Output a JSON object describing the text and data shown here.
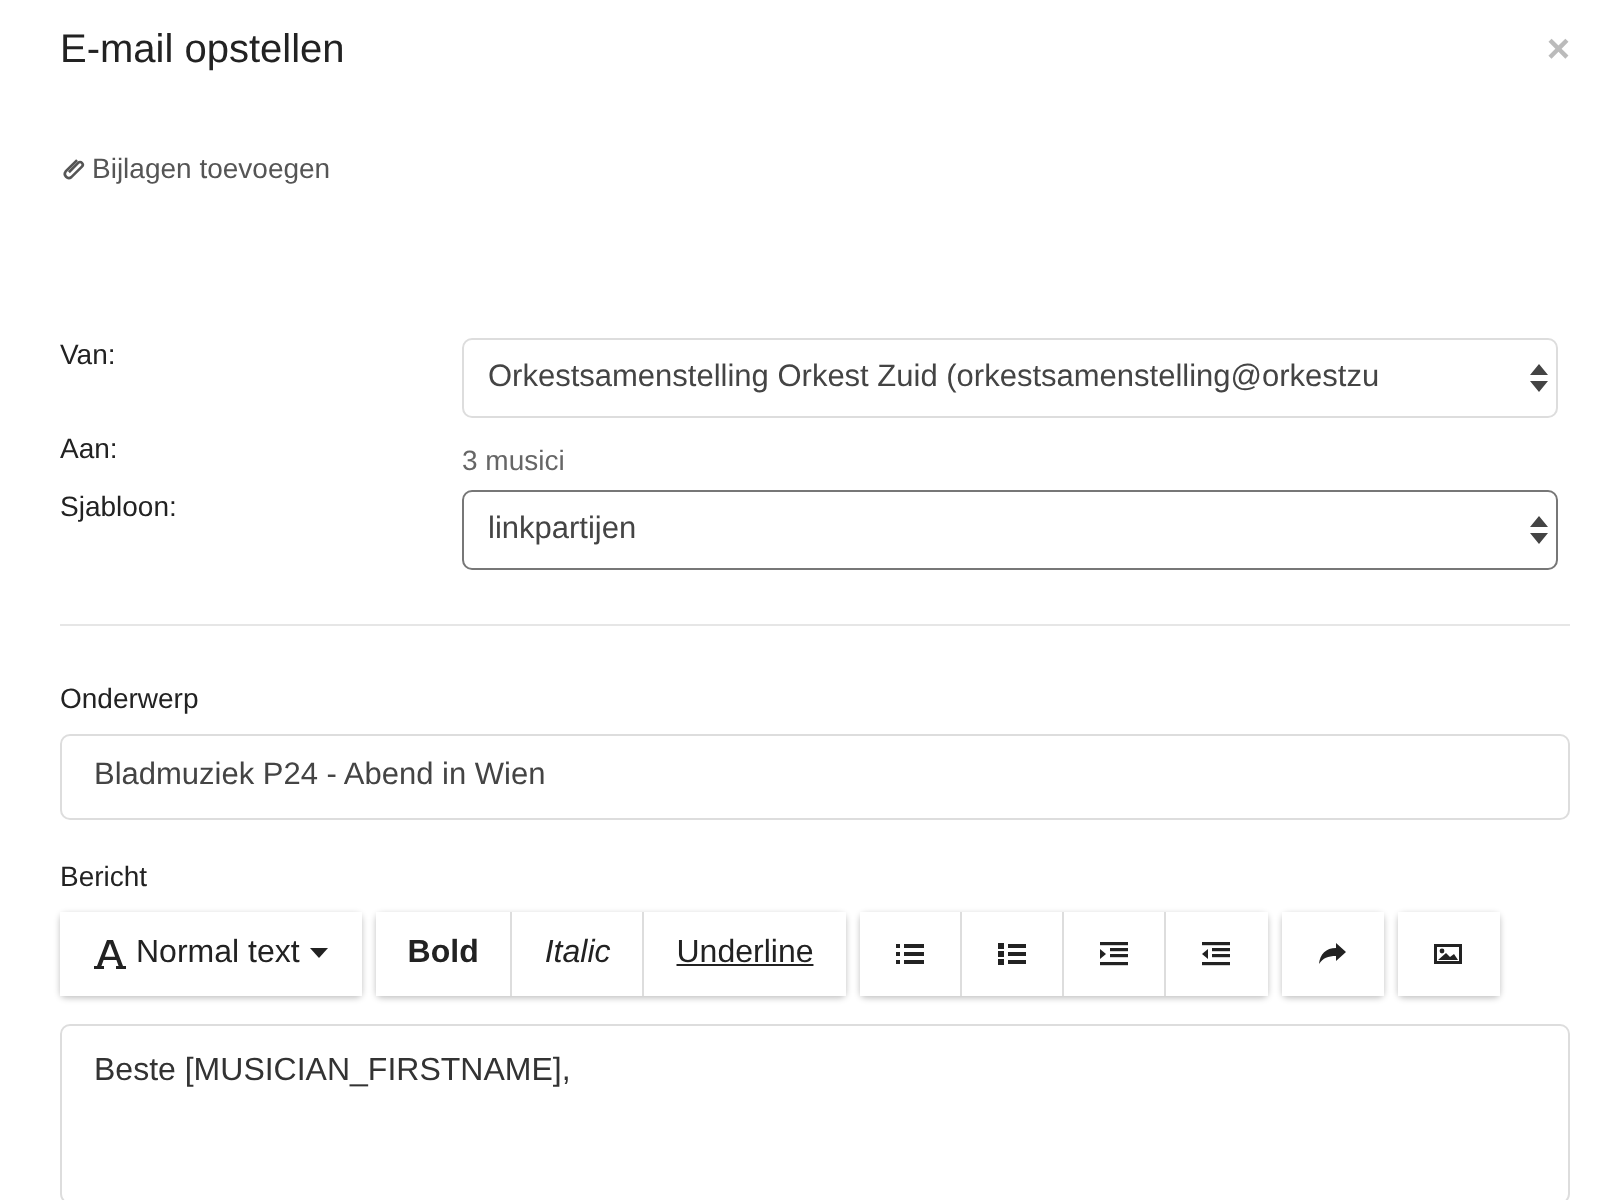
{
  "dialog": {
    "title": "E-mail opstellen",
    "close": "×"
  },
  "attachments": {
    "label": "Bijlagen toevoegen"
  },
  "fields": [
    {
      "kind": "select",
      "label": "Van:",
      "value": "Orkestsamenstelling Orkest Zuid (orkestsamenstelling@orkestzu",
      "focused": false
    },
    {
      "kind": "text",
      "label": "Aan:",
      "value": "3 musici"
    },
    {
      "kind": "select",
      "label": "Sjabloon:",
      "value": "linkpartijen",
      "focused": true
    }
  ],
  "subject": {
    "label": "Onderwerp",
    "value": "Bladmuziek P24 - Abend in Wien"
  },
  "message": {
    "label": "Bericht",
    "toolbar": [
      [
        {
          "kind": "format",
          "label": "Normal text"
        }
      ],
      [
        {
          "kind": "bold",
          "label": "Bold"
        },
        {
          "kind": "italic",
          "label": "Italic"
        },
        {
          "kind": "underline",
          "label": "Underline"
        }
      ],
      [
        {
          "kind": "bullet-list"
        },
        {
          "kind": "numbered-list"
        },
        {
          "kind": "indent"
        },
        {
          "kind": "outdent"
        }
      ],
      [
        {
          "kind": "redo"
        }
      ],
      [
        {
          "kind": "image"
        }
      ]
    ],
    "body": "Beste [MUSICIAN_FIRSTNAME],"
  }
}
